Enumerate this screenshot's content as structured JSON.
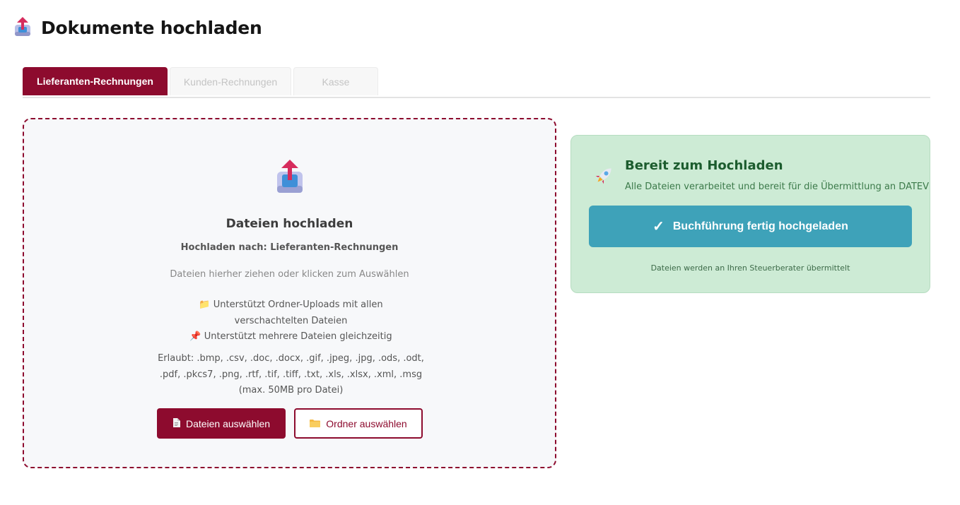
{
  "page": {
    "title": "Dokumente hochladen",
    "icon": "upload-tray-icon"
  },
  "tabs": [
    {
      "label": "Lieferanten-Rechnungen",
      "active": true
    },
    {
      "label": "Kunden-Rechnungen",
      "active": false
    },
    {
      "label": "Kasse",
      "active": false
    }
  ],
  "dropzone": {
    "icon": "upload-tray-icon",
    "title": "Dateien hochladen",
    "target": "Hochladen nach: Lieferanten-Rechnungen",
    "hint": "Dateien hierher ziehen oder klicken zum Auswählen",
    "features": [
      {
        "icon": "folder-icon",
        "text": "Unterstützt Ordner-Uploads mit allen verschachtelten Dateien"
      },
      {
        "icon": "pushpin-icon",
        "text": "Unterstützt mehrere Dateien gleichzeitig"
      }
    ],
    "allowed": "Erlaubt: .bmp, .csv, .doc, .docx, .gif, .jpeg, .jpg, .ods, .odt, .pdf, .pkcs7, .png, .rtf, .tif, .tiff, .txt, .xls, .xlsx, .xml, .msg (max. 50MB pro Datei)",
    "select_files_label": "Dateien auswählen",
    "select_folder_label": "Ordner auswählen"
  },
  "ready": {
    "icon": "rocket-icon",
    "title": "Bereit zum Hochladen",
    "subtitle": "Alle Dateien verarbeitet und bereit für die Übermittlung an DATEV",
    "button_label": "Buchführung fertig hochgeladen",
    "button_icon": "checkmark-icon",
    "footer": "Dateien werden an Ihren Steuerberater übermittelt"
  },
  "colors": {
    "brand": "#8d0b2e",
    "action": "#3ea2b9",
    "success_bg": "#cdebd5",
    "success_text": "#1c5c2e"
  }
}
